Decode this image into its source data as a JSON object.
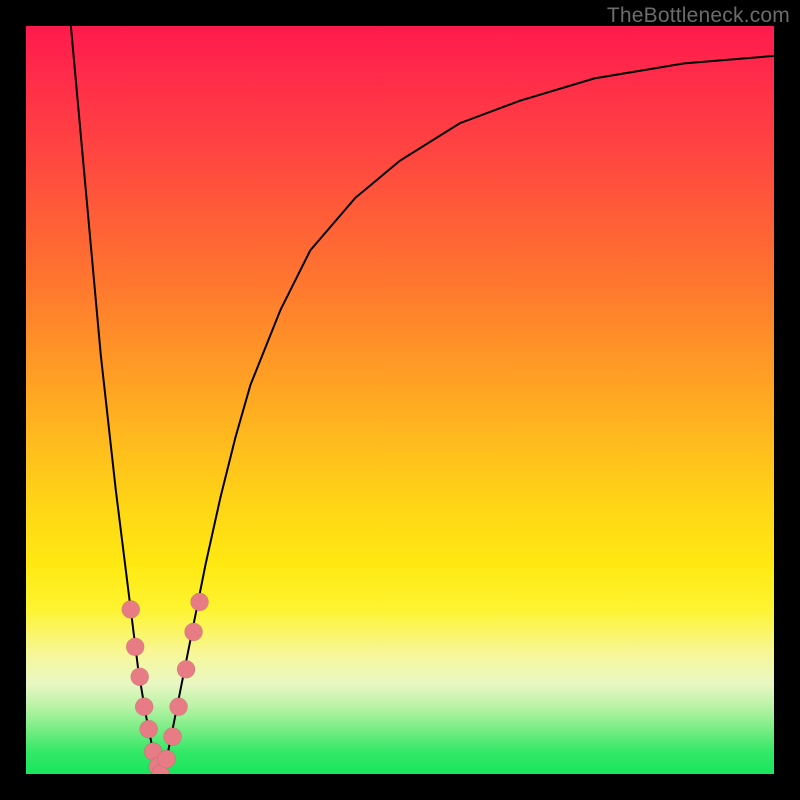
{
  "watermark": "TheBottleneck.com",
  "colors": {
    "curve": "#000000",
    "marker": "#e77c85",
    "gradient_top": "#ff1a4d",
    "gradient_bottom": "#17e65c",
    "frame": "#000000"
  },
  "chart_data": {
    "type": "line",
    "title": "",
    "xlabel": "",
    "ylabel": "",
    "xlim": [
      0,
      100
    ],
    "ylim": [
      0,
      100
    ],
    "grid": false,
    "legend": false,
    "series": [
      {
        "name": "bottleneck-curve",
        "x": [
          6,
          8,
          10,
          12,
          14,
          15,
          16,
          17,
          18,
          19,
          20,
          22,
          24,
          26,
          28,
          30,
          34,
          38,
          44,
          50,
          58,
          66,
          76,
          88,
          100
        ],
        "y": [
          100,
          78,
          56,
          38,
          22,
          14,
          8,
          3,
          0,
          3,
          8,
          18,
          28,
          37,
          45,
          52,
          62,
          70,
          77,
          82,
          87,
          90,
          93,
          95,
          96
        ]
      }
    ],
    "markers": {
      "series": "bottleneck-curve",
      "points": [
        {
          "x": 14.0,
          "y": 22
        },
        {
          "x": 14.6,
          "y": 17
        },
        {
          "x": 15.2,
          "y": 13
        },
        {
          "x": 15.8,
          "y": 9
        },
        {
          "x": 16.4,
          "y": 6
        },
        {
          "x": 17.0,
          "y": 3
        },
        {
          "x": 17.6,
          "y": 1
        },
        {
          "x": 18.0,
          "y": 0
        },
        {
          "x": 18.8,
          "y": 2
        },
        {
          "x": 19.6,
          "y": 5
        },
        {
          "x": 20.4,
          "y": 9
        },
        {
          "x": 21.4,
          "y": 14
        },
        {
          "x": 22.4,
          "y": 19
        },
        {
          "x": 23.2,
          "y": 23
        }
      ]
    },
    "annotations": []
  }
}
